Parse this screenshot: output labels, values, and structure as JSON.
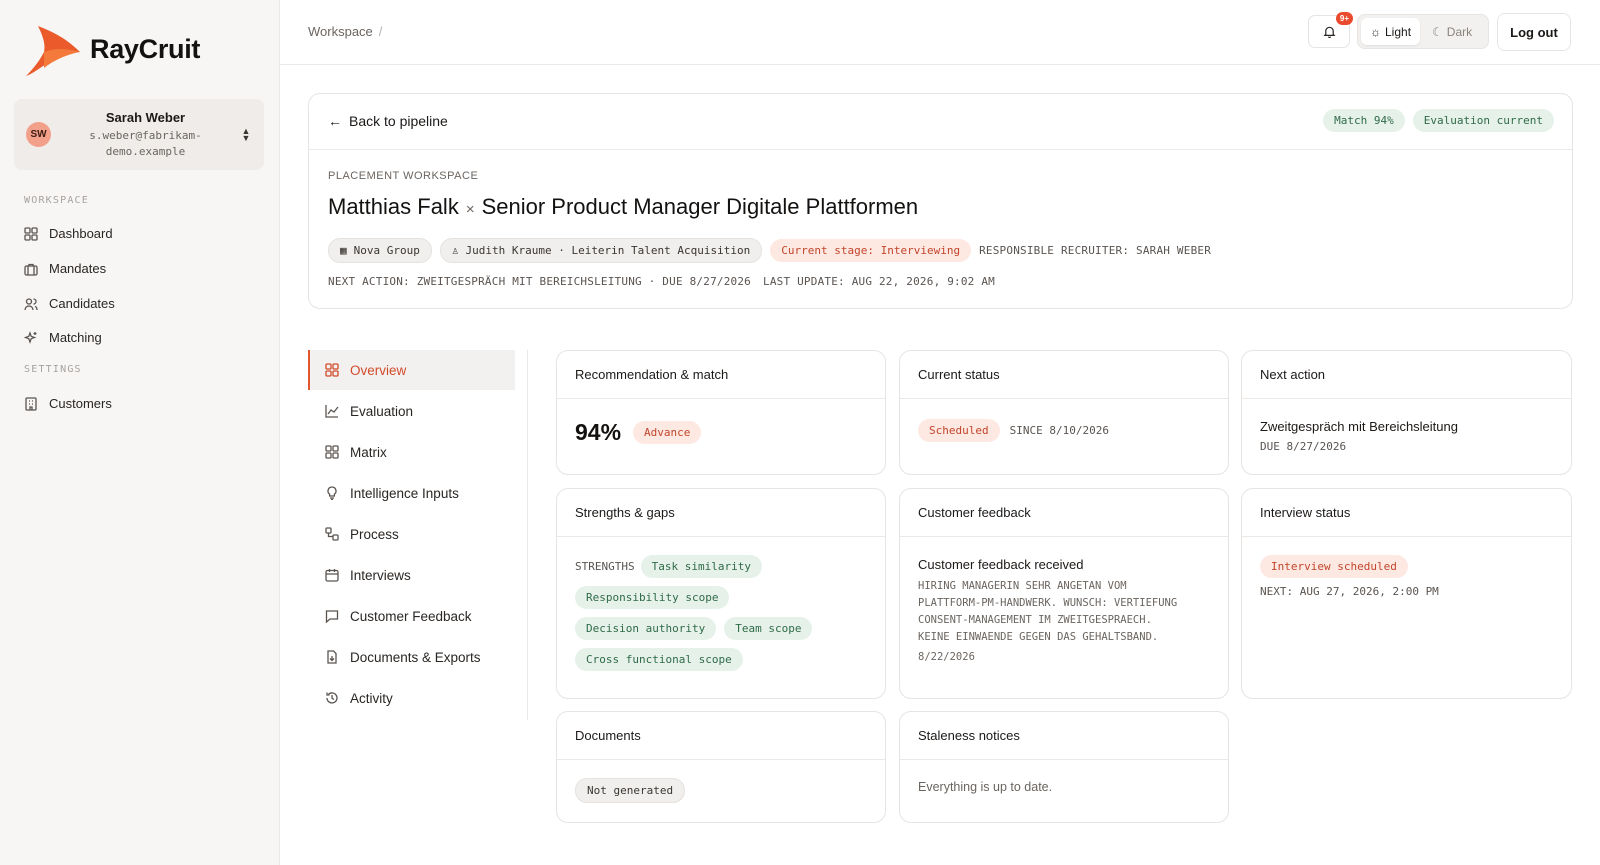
{
  "brand": {
    "name": "RayCruit"
  },
  "user": {
    "initials": "SW",
    "name": "Sarah Weber",
    "email": "s.weber@fabrikam-demo.example"
  },
  "sidebar": {
    "workspace_label": "WORKSPACE",
    "settings_label": "SETTINGS",
    "items": [
      {
        "label": "Dashboard",
        "icon": "grid-icon"
      },
      {
        "label": "Mandates",
        "icon": "briefcase-icon"
      },
      {
        "label": "Candidates",
        "icon": "users-icon"
      },
      {
        "label": "Matching",
        "icon": "sparkle-icon"
      },
      {
        "label": "Customers",
        "icon": "building-icon"
      }
    ]
  },
  "topbar": {
    "breadcrumb": "Workspace",
    "breadcrumb_sep": "/",
    "notifications_badge": "9+",
    "theme_light": "Light",
    "theme_dark": "Dark",
    "logout": "Log out"
  },
  "header": {
    "back_label": "Back to pipeline",
    "match_pill": "Match 94%",
    "eval_pill": "Evaluation current",
    "eyebrow": "PLACEMENT WORKSPACE",
    "candidate": "Matthias Falk",
    "times": "×",
    "role": "Senior Product Manager Digitale Plattformen",
    "company": "Nova Group",
    "contact": "Judith Kraume · Leiterin Talent Acquisition",
    "stage": "Current stage: Interviewing",
    "recruiter": "RESPONSIBLE RECRUITER: SARAH WEBER",
    "next_action": "NEXT ACTION: ZWEITGESPRÄCH MIT BEREICHSLEITUNG · DUE 8/27/2026",
    "last_update": "LAST UPDATE: AUG 22, 2026, 9:02 AM"
  },
  "tabs": [
    {
      "label": "Overview",
      "icon": "grid-icon"
    },
    {
      "label": "Evaluation",
      "icon": "chart-icon"
    },
    {
      "label": "Matrix",
      "icon": "grid-icon"
    },
    {
      "label": "Intelligence Inputs",
      "icon": "lightbulb-icon"
    },
    {
      "label": "Process",
      "icon": "workflow-icon"
    },
    {
      "label": "Interviews",
      "icon": "calendar-icon"
    },
    {
      "label": "Customer Feedback",
      "icon": "message-icon"
    },
    {
      "label": "Documents & Exports",
      "icon": "document-icon"
    },
    {
      "label": "Activity",
      "icon": "history-icon"
    }
  ],
  "cards": {
    "recommendation": {
      "title": "Recommendation & match",
      "pct": "94%",
      "badge": "Advance"
    },
    "status": {
      "title": "Current status",
      "badge": "Scheduled",
      "since": "SINCE 8/10/2026"
    },
    "next": {
      "title": "Next action",
      "text": "Zweitgespräch mit Bereichsleitung",
      "due": "DUE 8/27/2026"
    },
    "strengths": {
      "title": "Strengths & gaps",
      "label": "STRENGTHS",
      "items": [
        "Task similarity",
        "Responsibility scope",
        "Decision authority",
        "Team scope",
        "Cross functional scope"
      ]
    },
    "feedback": {
      "title": "Customer feedback",
      "heading": "Customer feedback received",
      "lines": [
        "HIRING MANAGERIN SEHR ANGETAN VOM",
        "PLATTFORM-PM-HANDWERK. WUNSCH: VERTIEFUNG",
        "CONSENT-MANAGEMENT IM ZWEITGESPRAECH.",
        "KEINE EINWAENDE GEGEN DAS GEHALTSBAND."
      ],
      "date": "8/22/2026"
    },
    "interview": {
      "title": "Interview status",
      "badge": "Interview scheduled",
      "next": "NEXT: AUG 27, 2026, 2:00 PM"
    },
    "documents": {
      "title": "Documents",
      "badge": "Not generated"
    },
    "staleness": {
      "title": "Staleness notices",
      "text": "Everything is up to date."
    }
  },
  "colors": {
    "accent": "#e2552f",
    "green_pill": "#e6f1ea",
    "red_pill": "#fde8e2"
  }
}
